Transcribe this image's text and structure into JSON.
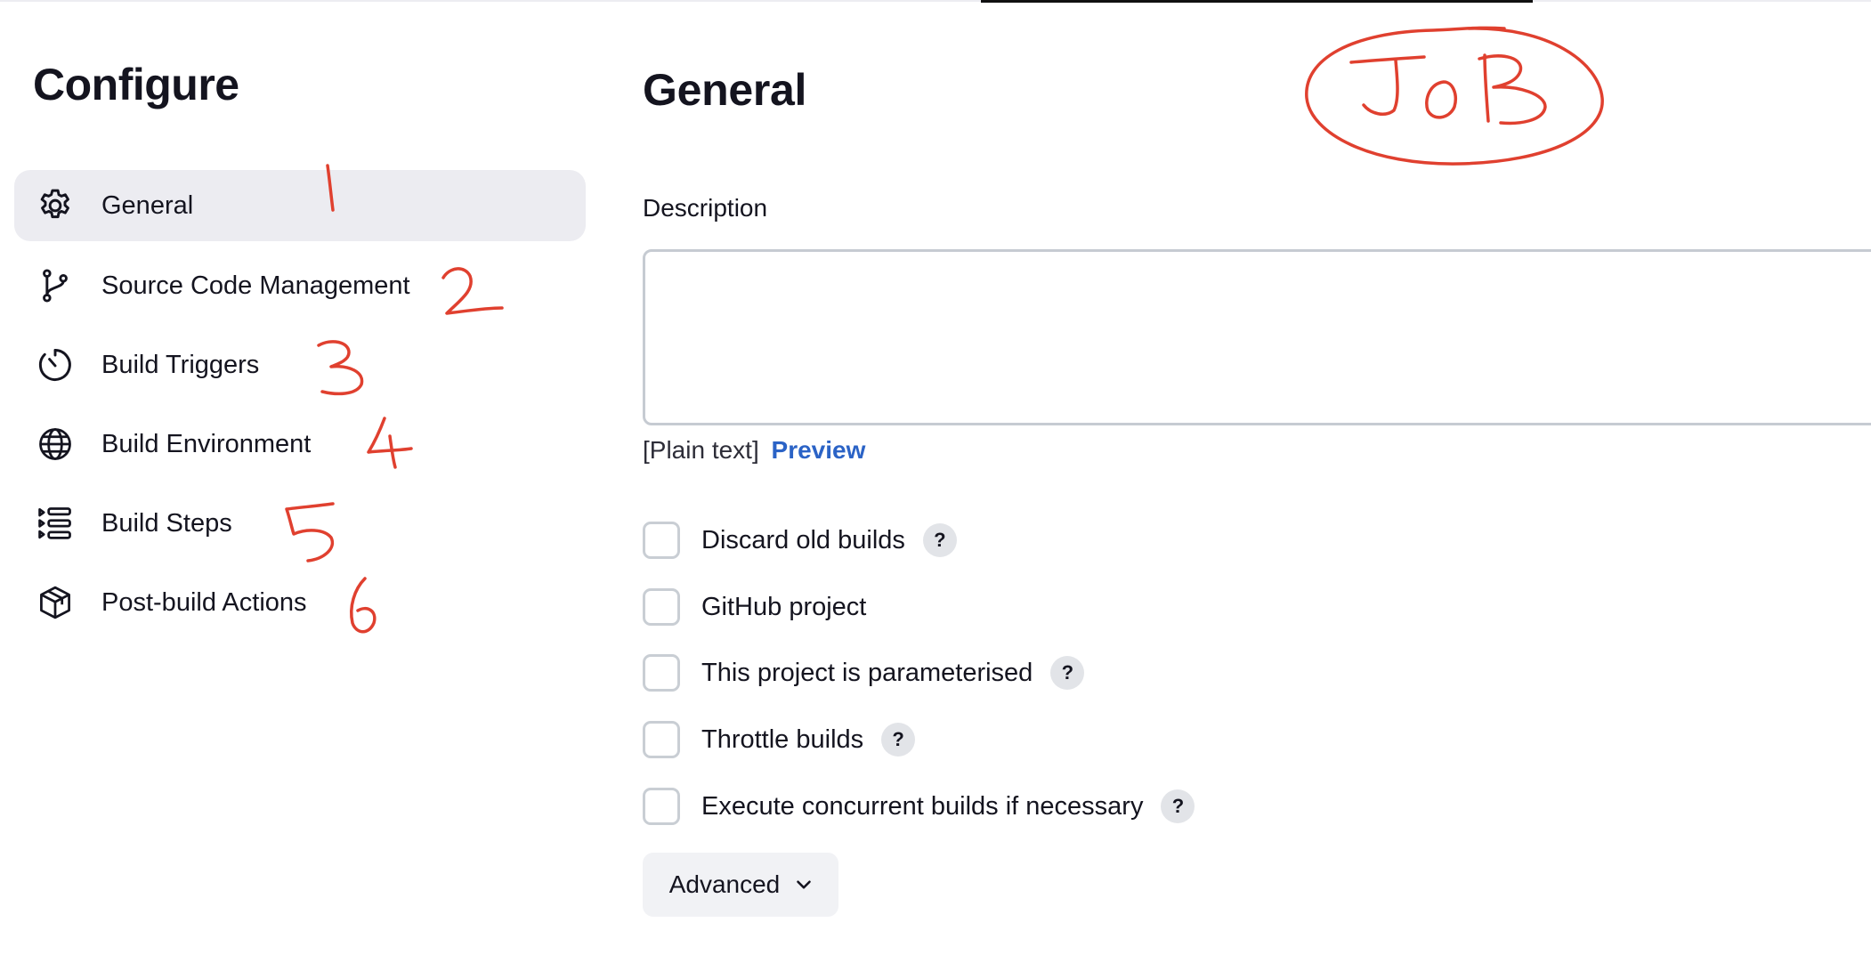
{
  "sidebar": {
    "title": "Configure",
    "items": [
      {
        "label": "General",
        "icon": "gear-icon",
        "active": true
      },
      {
        "label": "Source Code Management",
        "icon": "git-branch-icon",
        "active": false
      },
      {
        "label": "Build Triggers",
        "icon": "timer-icon",
        "active": false
      },
      {
        "label": "Build Environment",
        "icon": "globe-icon",
        "active": false
      },
      {
        "label": "Build Steps",
        "icon": "list-steps-icon",
        "active": false
      },
      {
        "label": "Post-build Actions",
        "icon": "package-icon",
        "active": false
      }
    ]
  },
  "main": {
    "title": "General",
    "description_label": "Description",
    "description_value": "",
    "description_hint": "[Plain text]",
    "preview_link": "Preview",
    "options": [
      {
        "label": "Discard old builds",
        "checked": false,
        "has_help": true
      },
      {
        "label": "GitHub project",
        "checked": false,
        "has_help": false
      },
      {
        "label": "This project is parameterised",
        "checked": false,
        "has_help": true
      },
      {
        "label": "Throttle builds",
        "checked": false,
        "has_help": true
      },
      {
        "label": "Execute concurrent builds if necessary",
        "checked": false,
        "has_help": true
      }
    ],
    "help_glyph": "?",
    "advanced_label": "Advanced"
  },
  "annotations": {
    "color": "#e0402f",
    "marks": [
      "1",
      "2",
      "3",
      "4",
      "5",
      "6",
      "JOB"
    ]
  },
  "colors": {
    "active_nav_bg": "#ececf1",
    "link": "#2b63c6",
    "border": "#c9ced4"
  }
}
